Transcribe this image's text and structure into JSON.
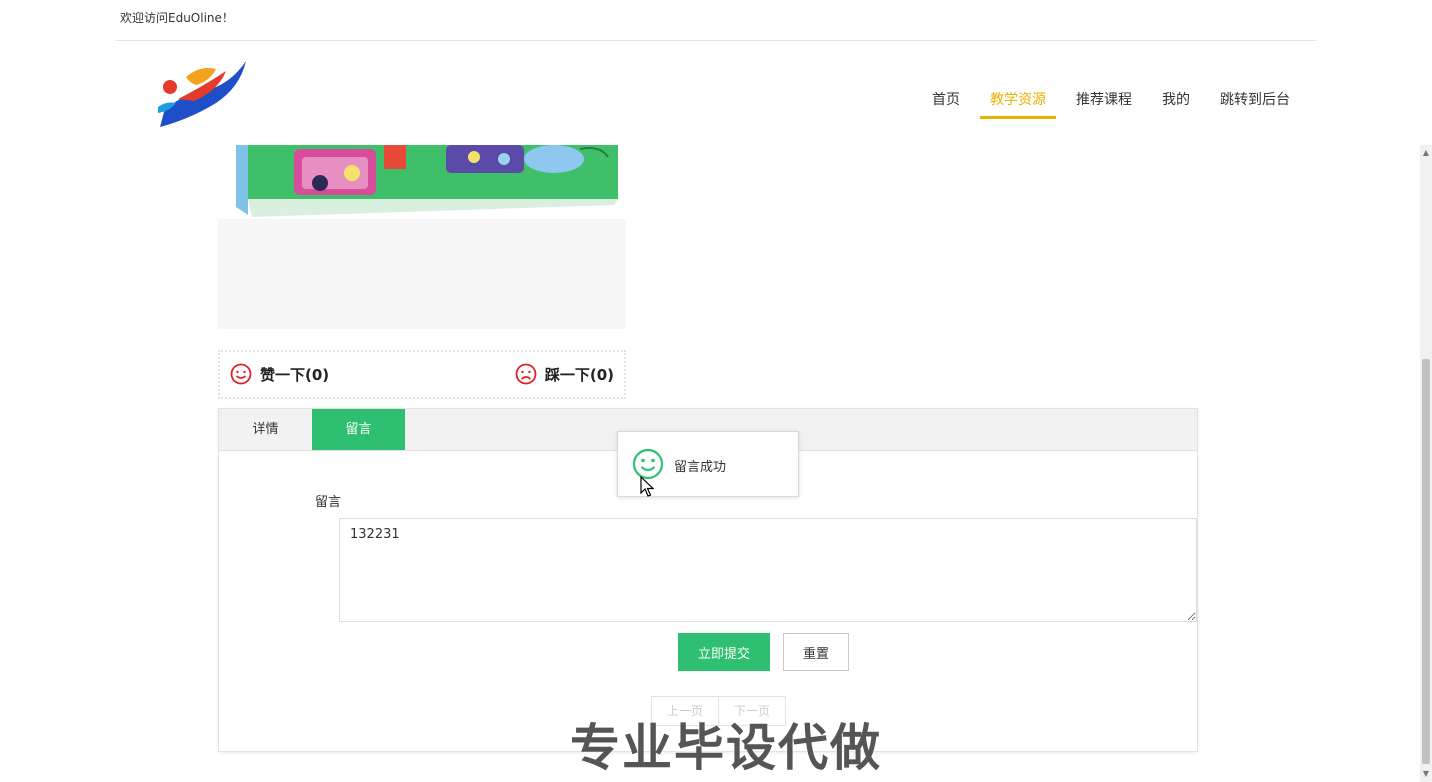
{
  "topbar": {
    "welcome": "欢迎访问EduOline！"
  },
  "nav": {
    "items": [
      {
        "label": "首页",
        "active": false
      },
      {
        "label": "教学资源",
        "active": true
      },
      {
        "label": "推荐课程",
        "active": false
      },
      {
        "label": "我的",
        "active": false
      },
      {
        "label": "跳转到后台",
        "active": false
      }
    ],
    "accent_color": "#e8b200"
  },
  "votes": {
    "like_label": "赞一下(0)",
    "dislike_label": "踩一下(0)"
  },
  "tabs": [
    {
      "label": "详情",
      "active": false
    },
    {
      "label": "留言",
      "active": true
    }
  ],
  "comment_form": {
    "label": "留言",
    "value": "132231",
    "submit_label": "立即提交",
    "reset_label": "重置"
  },
  "pager": {
    "prev": "上一页",
    "next": "下一页"
  },
  "toast": {
    "message": "留言成功",
    "icon": "smile-icon"
  },
  "watermark": "专业毕设代做",
  "colors": {
    "primary_green": "#2fbf71",
    "vote_red": "#e0202a"
  }
}
